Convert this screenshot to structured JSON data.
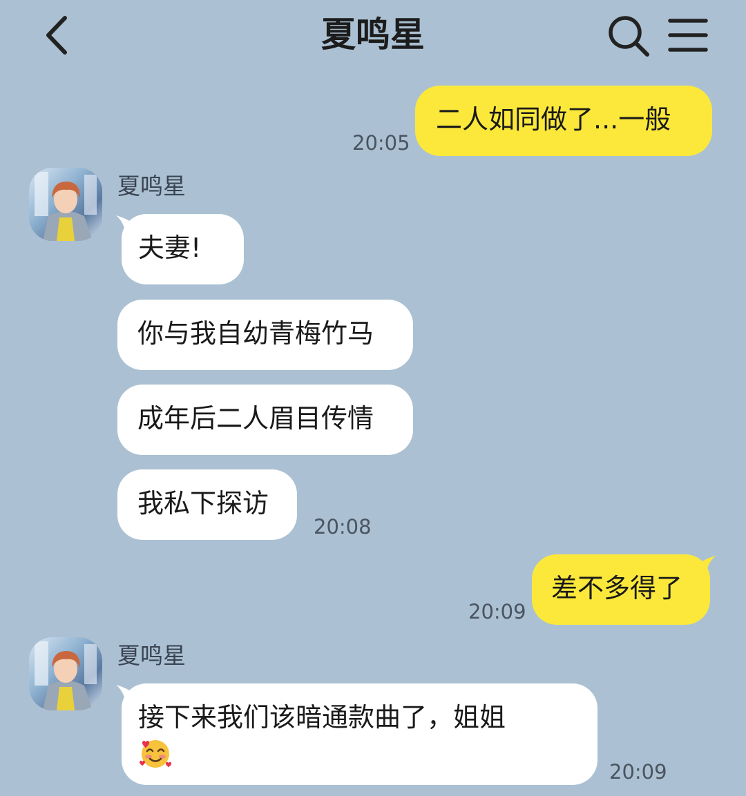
{
  "header": {
    "title": "夏鸣星",
    "back_icon": "chevron-left-icon",
    "search_icon": "search-icon",
    "menu_icon": "menu-icon"
  },
  "colors": {
    "background": "#abc1d3",
    "my_bubble": "#fbe83b",
    "their_bubble": "#ffffff"
  },
  "messages": [
    {
      "from": "me",
      "text": "二人如同做了...一般",
      "time": "20:05"
    },
    {
      "from": "them",
      "sender": "夏鸣星",
      "text": "夫妻!"
    },
    {
      "from": "them",
      "text": "你与我自幼青梅竹马"
    },
    {
      "from": "them",
      "text": "成年后二人眉目传情"
    },
    {
      "from": "them",
      "text": "我私下探访",
      "time": "20:08"
    },
    {
      "from": "me",
      "text": "差不多得了",
      "time": "20:09"
    },
    {
      "from": "them",
      "sender": "夏鸣星",
      "text": "接下来我们该暗通款曲了，姐姐",
      "emoji": "smiling-face-with-hearts-icon",
      "time": "20:09"
    }
  ]
}
